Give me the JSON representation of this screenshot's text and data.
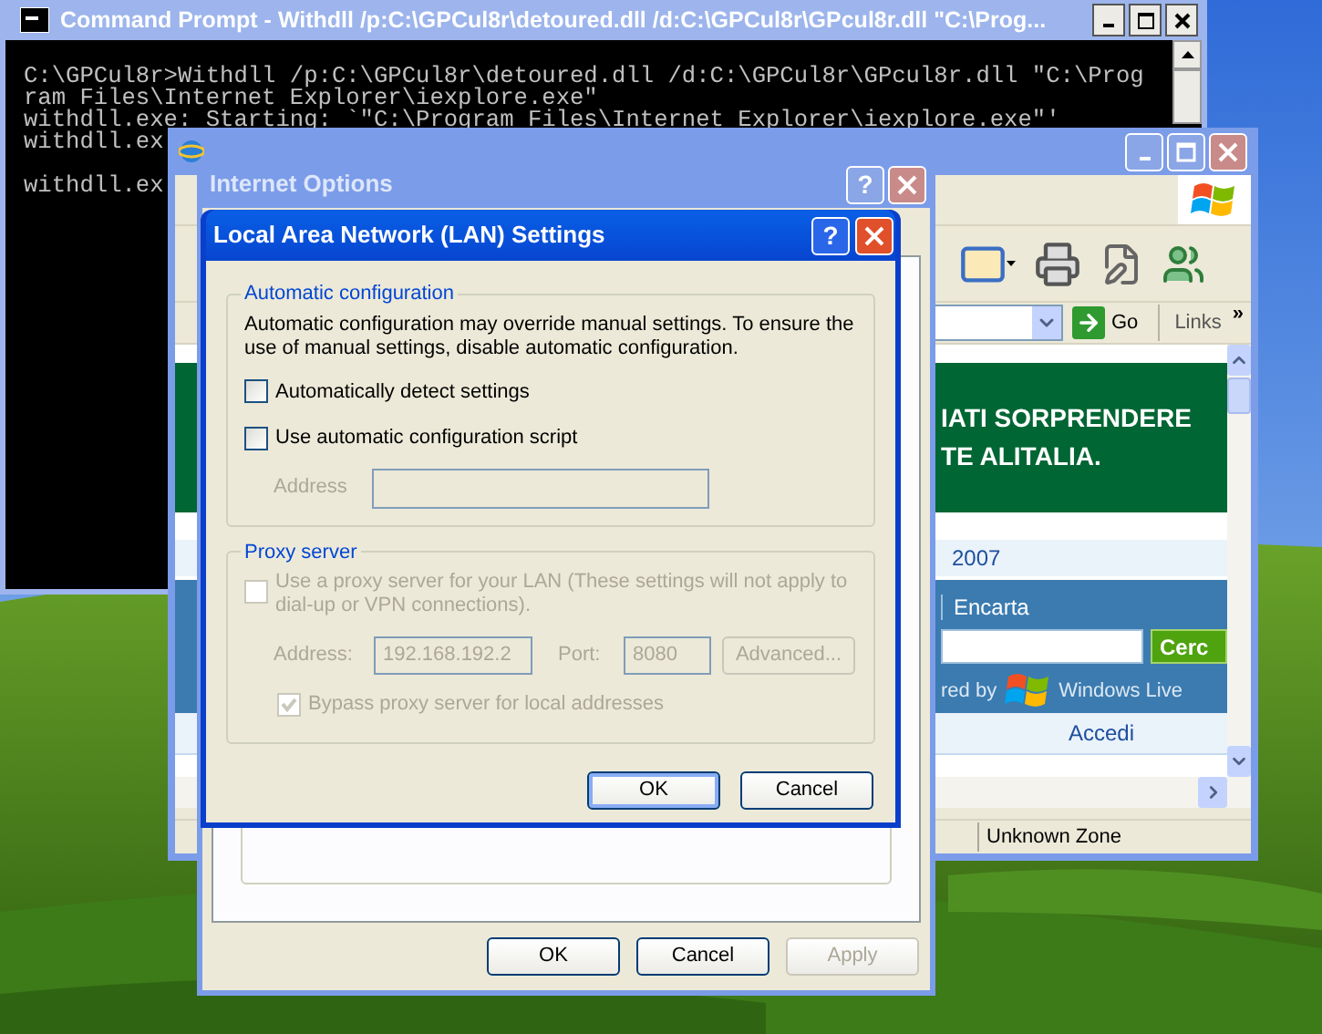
{
  "console": {
    "title": "Command Prompt - Withdll /p:C:\\GPCul8r\\detoured.dll /d:C:\\GPCul8r\\GPcul8r.dll \"C:\\Prog...",
    "blocks": [
      [
        "C:\\GPCul8r>Withdll /p:C:\\GPCul8r\\detoured.dll /d:C:\\GPCul8r\\GPcul8r.dll \"C:\\Prog",
        "ram Files\\Internet Explorer\\iexplore.exe\"",
        "withdll.exe: Starting: `\"C:\\Program Files\\Internet Explorer\\iexplore.exe\"'",
        "withdll.ex"
      ],
      [
        "withdll.ex"
      ]
    ]
  },
  "browser": {
    "go": "Go",
    "links": "Links",
    "links_more": "»",
    "banner": [
      "IATI SORPRENDERE",
      "TE ALITALIA."
    ],
    "date": "2007",
    "nav_link": "Encarta",
    "search_button": "Cerc",
    "powered_by": "red by",
    "brand": "Windows Live",
    "signin": "Accedi",
    "zone": "Unknown Zone"
  },
  "internet_options": {
    "title": "Internet Options",
    "help": "?",
    "buttons": [
      {
        "label": "OK",
        "disabled": false
      },
      {
        "label": "Cancel",
        "disabled": false
      },
      {
        "label": "Apply",
        "disabled": true
      }
    ]
  },
  "lan": {
    "title": "Local Area Network (LAN) Settings",
    "help": "?",
    "automatic": {
      "legend": "Automatic configuration",
      "description": "Automatic configuration may override manual settings.  To ensure the use of manual settings, disable automatic configuration.",
      "options": [
        {
          "label": "Automatically detect settings",
          "checked": false,
          "disabled": false
        },
        {
          "label": "Use automatic configuration script",
          "checked": false,
          "disabled": false
        }
      ],
      "address": {
        "label": "Address",
        "disabled": true
      }
    },
    "proxy": {
      "legend": "Proxy server",
      "disabled": true,
      "use_proxy": {
        "label": "Use a proxy server for your LAN (These settings will not apply to dial-up or VPN connections).",
        "checked": false,
        "disabled": true
      },
      "address_label": "Address:",
      "address": "192.168.192.2",
      "port_label": "Port:",
      "port": "8080",
      "advanced": "Advanced...",
      "bypass": {
        "label": "Bypass proxy server for local addresses",
        "checked": true,
        "disabled": true
      }
    },
    "buttons": [
      {
        "label": "OK",
        "default": true
      },
      {
        "label": "Cancel",
        "default": false
      }
    ]
  }
}
